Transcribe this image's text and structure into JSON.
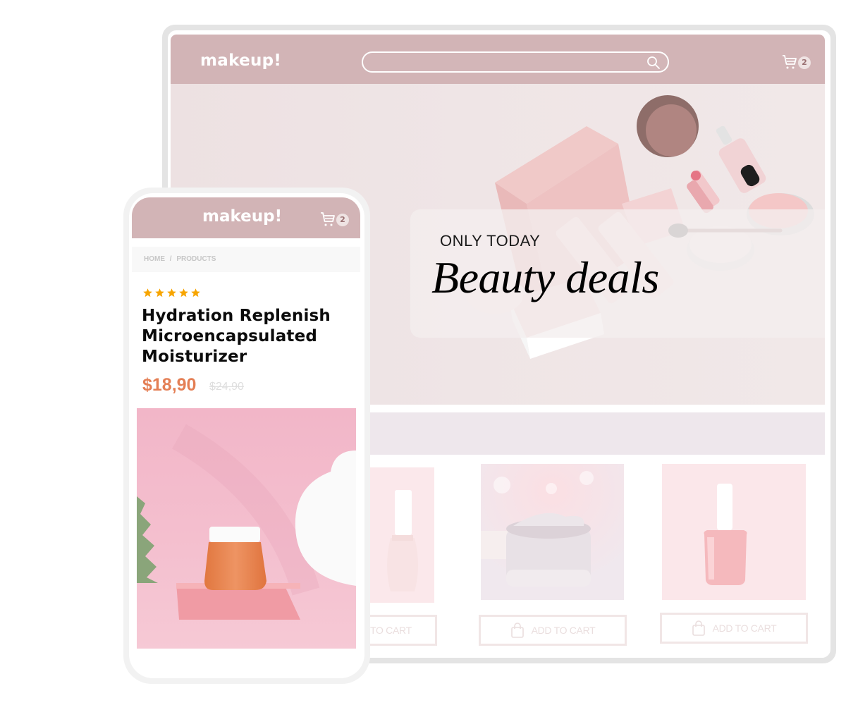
{
  "desktop": {
    "header": {
      "logo": "makeup!",
      "search": {
        "value": "",
        "placeholder": "",
        "icon": "search-icon"
      },
      "cart": {
        "icon": "cart-icon",
        "count": "2"
      }
    },
    "hero": {
      "kicker": "ONLY TODAY",
      "title": "Beauty deals"
    },
    "products": [
      {
        "image": "nail-polish-white",
        "button": "ADD TO CART",
        "button_visible": "TO CART"
      },
      {
        "image": "cream-jar",
        "button": "ADD TO CART"
      },
      {
        "image": "nail-polish-pink",
        "button": "ADD TO CART"
      }
    ]
  },
  "mobile": {
    "header": {
      "logo": "makeup!",
      "cart": {
        "icon": "cart-icon",
        "count": "2"
      }
    },
    "breadcrumb": [
      "HOME",
      "/",
      "PRODUCTS"
    ],
    "product": {
      "rating": 5,
      "rating_max": 5,
      "title": "Hydration Replenish Microencapsulated Moisturizer",
      "price": "$18,90",
      "old_price": "$24,90"
    }
  },
  "colors": {
    "header_bg": "#d2b4b6",
    "price": "#e47f55",
    "star": "#f7a500",
    "badge_bg": "#efe3e3"
  }
}
